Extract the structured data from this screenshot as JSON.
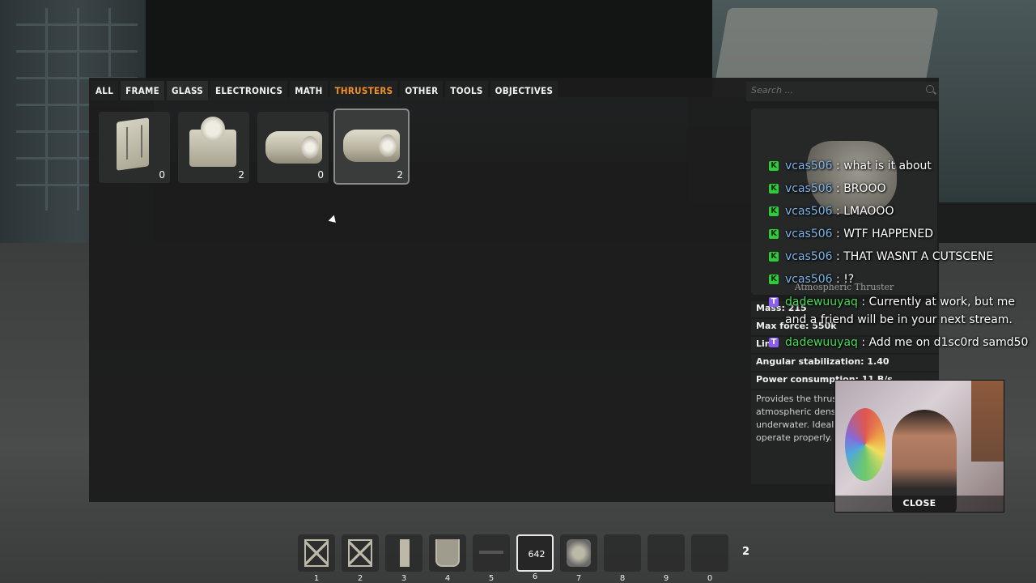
{
  "tabs": [
    {
      "label": "ALL"
    },
    {
      "label": "FRAME"
    },
    {
      "label": "GLASS"
    },
    {
      "label": "ELECTRONICS"
    },
    {
      "label": "MATH"
    },
    {
      "label": "THRUSTERS"
    },
    {
      "label": "OTHER"
    },
    {
      "label": "TOOLS"
    },
    {
      "label": "OBJECTIVES"
    }
  ],
  "active_tab": "THRUSTERS",
  "colors": {
    "active_tab": "#f0902a",
    "chat_user": "#7db3e8",
    "chat_user_green": "#48d958",
    "badge_green": "#2fcc3a",
    "badge_twitch": "#8b5cf6"
  },
  "search": {
    "placeholder": "Search ..."
  },
  "items": [
    {
      "icon": "frame-thruster-icon",
      "count": "0"
    },
    {
      "icon": "box-thruster-icon",
      "count": "2"
    },
    {
      "icon": "cylinder-thruster-icon",
      "count": "0"
    },
    {
      "icon": "atmospheric-thruster-icon",
      "count": "2",
      "selected": true
    }
  ],
  "details": {
    "name": "Atmospheric Thruster",
    "stats": [
      "Mass: 215",
      "Max force: 550k",
      "Lin",
      "Angular stabilization: 1.40",
      "Power consumption: 11 B/s"
    ],
    "description": "Provides the thrust spaceship. Its effic atmospheric densi function in space. I underwater. Ideal f flights. Requires ele operate properly."
  },
  "chat": [
    {
      "user": "vcas506",
      "text": ": what is it about",
      "badge": "K"
    },
    {
      "user": "vcas506",
      "text": ": BROOO",
      "badge": "K"
    },
    {
      "user": "vcas506",
      "text": ": LMAOOO",
      "badge": "K"
    },
    {
      "user": "vcas506",
      "text": ": WTF HAPPENED",
      "badge": "K"
    },
    {
      "user": "vcas506",
      "text": ": THAT WASNT A CUTSCENE",
      "badge": "K"
    },
    {
      "user": "vcas506",
      "text": ": !?",
      "badge": "K"
    },
    {
      "user": "dadewuuyaq",
      "text": ": Currently at work, but me and a friend will be in your next stream.",
      "badge": "T"
    },
    {
      "user": "dadewuuyaq",
      "text": ": Add me on d1sc0rd samd50",
      "badge": "T"
    }
  ],
  "webcam": {
    "close_label": "CLOSE"
  },
  "hotbar": [
    {
      "num": "1",
      "icon": "frame-block-icon"
    },
    {
      "num": "2",
      "icon": "frame-block-icon"
    },
    {
      "num": "3",
      "icon": "pillar-block-icon"
    },
    {
      "num": "4",
      "icon": "u-block-icon"
    },
    {
      "num": "5",
      "icon": "plate-icon"
    },
    {
      "num": "6",
      "icon": "counter-display-icon",
      "text": "642",
      "selected": true
    },
    {
      "num": "7",
      "icon": "robot-icon"
    },
    {
      "num": "8",
      "icon": ""
    },
    {
      "num": "9",
      "icon": ""
    },
    {
      "num": "0",
      "icon": ""
    }
  ],
  "hotbar_page": "2"
}
